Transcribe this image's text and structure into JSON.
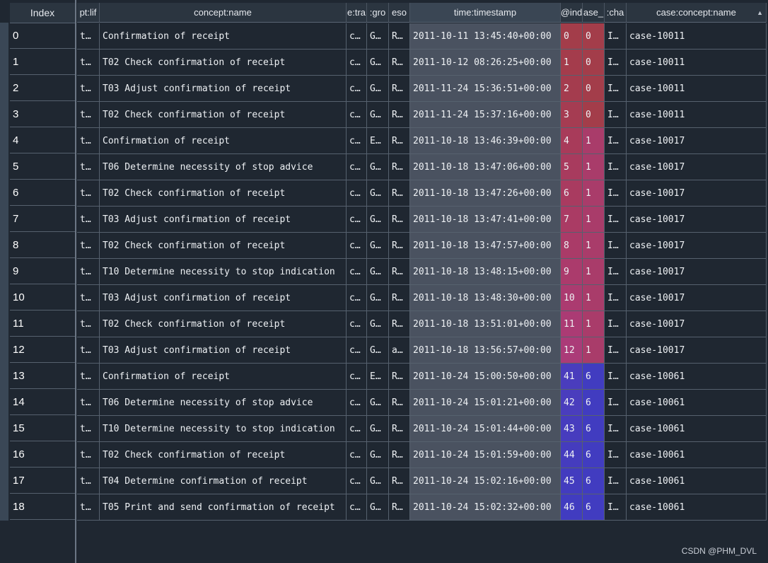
{
  "index_header": "Index",
  "columns": [
    {
      "key": "lifecycle",
      "label": "pt:lif"
    },
    {
      "key": "name",
      "label": "concept:name"
    },
    {
      "key": "trans",
      "label": "e:tra"
    },
    {
      "key": "group",
      "label": ":gro"
    },
    {
      "key": "resource",
      "label": "eso"
    },
    {
      "key": "timestamp",
      "label": "time:timestamp"
    },
    {
      "key": "index",
      "label": "@ind"
    },
    {
      "key": "case_idx",
      "label": "ase_"
    },
    {
      "key": "change",
      "label": ":cha"
    },
    {
      "key": "case",
      "label": "case:concept:name"
    }
  ],
  "sort_icon": "sort-triangle-icon",
  "rows": [
    {
      "idx": "0",
      "lifecycle": "t…",
      "name": "Confirmation of receipt",
      "trans": "c…",
      "group": "G…",
      "resource": "R…",
      "timestamp": "2011-10-11 13:45:40+00:00",
      "index": "0",
      "case_idx": "0",
      "change": "I…",
      "case": "case-10011"
    },
    {
      "idx": "1",
      "lifecycle": "t…",
      "name": "T02 Check confirmation of receipt",
      "trans": "c…",
      "group": "G…",
      "resource": "R…",
      "timestamp": "2011-10-12 08:26:25+00:00",
      "index": "1",
      "case_idx": "0",
      "change": "I…",
      "case": "case-10011"
    },
    {
      "idx": "2",
      "lifecycle": "t…",
      "name": "T03 Adjust confirmation of receipt",
      "trans": "c…",
      "group": "G…",
      "resource": "R…",
      "timestamp": "2011-11-24 15:36:51+00:00",
      "index": "2",
      "case_idx": "0",
      "change": "I…",
      "case": "case-10011"
    },
    {
      "idx": "3",
      "lifecycle": "t…",
      "name": "T02 Check confirmation of receipt",
      "trans": "c…",
      "group": "G…",
      "resource": "R…",
      "timestamp": "2011-11-24 15:37:16+00:00",
      "index": "3",
      "case_idx": "0",
      "change": "I…",
      "case": "case-10011"
    },
    {
      "idx": "4",
      "lifecycle": "t…",
      "name": "Confirmation of receipt",
      "trans": "c…",
      "group": "E…",
      "resource": "R…",
      "timestamp": "2011-10-18 13:46:39+00:00",
      "index": "4",
      "case_idx": "1",
      "change": "I…",
      "case": "case-10017"
    },
    {
      "idx": "5",
      "lifecycle": "t…",
      "name": "T06 Determine necessity of stop advice",
      "trans": "c…",
      "group": "G…",
      "resource": "R…",
      "timestamp": "2011-10-18 13:47:06+00:00",
      "index": "5",
      "case_idx": "1",
      "change": "I…",
      "case": "case-10017"
    },
    {
      "idx": "6",
      "lifecycle": "t…",
      "name": "T02 Check confirmation of receipt",
      "trans": "c…",
      "group": "G…",
      "resource": "R…",
      "timestamp": "2011-10-18 13:47:26+00:00",
      "index": "6",
      "case_idx": "1",
      "change": "I…",
      "case": "case-10017"
    },
    {
      "idx": "7",
      "lifecycle": "t…",
      "name": "T03 Adjust confirmation of receipt",
      "trans": "c…",
      "group": "G…",
      "resource": "R…",
      "timestamp": "2011-10-18 13:47:41+00:00",
      "index": "7",
      "case_idx": "1",
      "change": "I…",
      "case": "case-10017"
    },
    {
      "idx": "8",
      "lifecycle": "t…",
      "name": "T02 Check confirmation of receipt",
      "trans": "c…",
      "group": "G…",
      "resource": "R…",
      "timestamp": "2011-10-18 13:47:57+00:00",
      "index": "8",
      "case_idx": "1",
      "change": "I…",
      "case": "case-10017"
    },
    {
      "idx": "9",
      "lifecycle": "t…",
      "name": "T10 Determine necessity to stop indication",
      "trans": "c…",
      "group": "G…",
      "resource": "R…",
      "timestamp": "2011-10-18 13:48:15+00:00",
      "index": "9",
      "case_idx": "1",
      "change": "I…",
      "case": "case-10017"
    },
    {
      "idx": "10",
      "lifecycle": "t…",
      "name": "T03 Adjust confirmation of receipt",
      "trans": "c…",
      "group": "G…",
      "resource": "R…",
      "timestamp": "2011-10-18 13:48:30+00:00",
      "index": "10",
      "case_idx": "1",
      "change": "I…",
      "case": "case-10017"
    },
    {
      "idx": "11",
      "lifecycle": "t…",
      "name": "T02 Check confirmation of receipt",
      "trans": "c…",
      "group": "G…",
      "resource": "R…",
      "timestamp": "2011-10-18 13:51:01+00:00",
      "index": "11",
      "case_idx": "1",
      "change": "I…",
      "case": "case-10017"
    },
    {
      "idx": "12",
      "lifecycle": "t…",
      "name": "T03 Adjust confirmation of receipt",
      "trans": "c…",
      "group": "G…",
      "resource": "a…",
      "timestamp": "2011-10-18 13:56:57+00:00",
      "index": "12",
      "case_idx": "1",
      "change": "I…",
      "case": "case-10017"
    },
    {
      "idx": "13",
      "lifecycle": "t…",
      "name": "Confirmation of receipt",
      "trans": "c…",
      "group": "E…",
      "resource": "R…",
      "timestamp": "2011-10-24 15:00:50+00:00",
      "index": "41",
      "case_idx": "6",
      "change": "I…",
      "case": "case-10061"
    },
    {
      "idx": "14",
      "lifecycle": "t…",
      "name": "T06 Determine necessity of stop advice",
      "trans": "c…",
      "group": "G…",
      "resource": "R…",
      "timestamp": "2011-10-24 15:01:21+00:00",
      "index": "42",
      "case_idx": "6",
      "change": "I…",
      "case": "case-10061"
    },
    {
      "idx": "15",
      "lifecycle": "t…",
      "name": "T10 Determine necessity to stop indication",
      "trans": "c…",
      "group": "G…",
      "resource": "R…",
      "timestamp": "2011-10-24 15:01:44+00:00",
      "index": "43",
      "case_idx": "6",
      "change": "I…",
      "case": "case-10061"
    },
    {
      "idx": "16",
      "lifecycle": "t…",
      "name": "T02 Check confirmation of receipt",
      "trans": "c…",
      "group": "G…",
      "resource": "R…",
      "timestamp": "2011-10-24 15:01:59+00:00",
      "index": "44",
      "case_idx": "6",
      "change": "I…",
      "case": "case-10061"
    },
    {
      "idx": "17",
      "lifecycle": "t…",
      "name": "T04 Determine confirmation of receipt",
      "trans": "c…",
      "group": "G…",
      "resource": "R…",
      "timestamp": "2011-10-24 15:02:16+00:00",
      "index": "45",
      "case_idx": "6",
      "change": "I…",
      "case": "case-10061"
    },
    {
      "idx": "18",
      "lifecycle": "t…",
      "name": "T05 Print and send confirmation of receipt",
      "trans": "c…",
      "group": "G…",
      "resource": "R…",
      "timestamp": "2011-10-24 15:02:32+00:00",
      "index": "46",
      "case_idx": "6",
      "change": "I…",
      "case": "case-10061"
    }
  ],
  "cell_colors": {
    "index": [
      "#a33d4a",
      "#a43c4c",
      "#a43c4e",
      "#a53c52",
      "#a83b5a",
      "#a83b5e",
      "#a93b60",
      "#aa3b64",
      "#aa3b68",
      "#ab3b6c",
      "#ab3b70",
      "#ab3b74",
      "#ab3b78",
      "#4a3dbd",
      "#4a3dbd",
      "#473cbe",
      "#453cbe",
      "#433cbf",
      "#413cc0"
    ],
    "case_idx": [
      "#a33d4a",
      "#a33d4a",
      "#a33d4a",
      "#a33d4a",
      "#a93c6a",
      "#a93c6a",
      "#a93c6a",
      "#a93c6a",
      "#a93c6a",
      "#a93c6a",
      "#a93c6a",
      "#a93c6a",
      "#a93c6a",
      "#413cc0",
      "#413cc0",
      "#413cc0",
      "#413cc0",
      "#413cc0",
      "#413cc0"
    ]
  },
  "watermark": "CSDN @PHM_DVL"
}
